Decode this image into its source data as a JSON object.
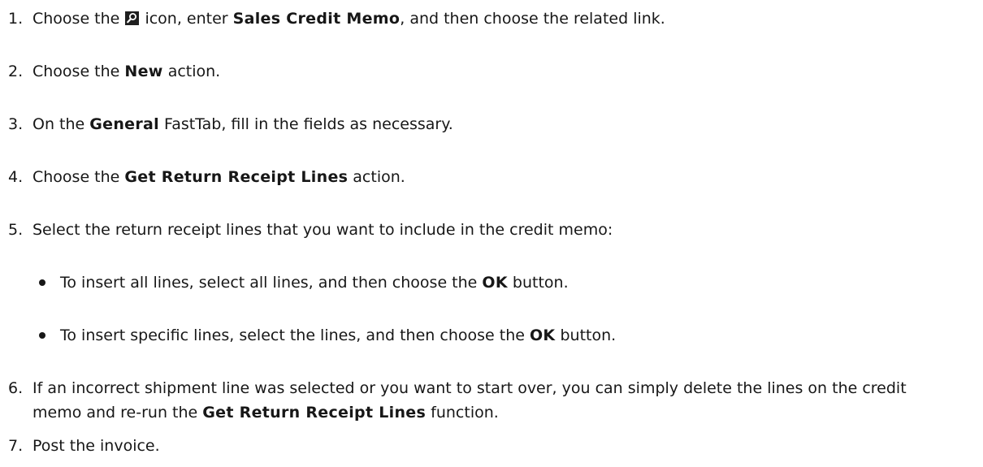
{
  "steps": [
    {
      "number": "1.",
      "parts": [
        {
          "t": "Choose the ",
          "b": false
        },
        {
          "icon": "search-icon"
        },
        {
          "t": " icon, enter ",
          "b": false
        },
        {
          "t": "Sales Credit Memo",
          "b": true
        },
        {
          "t": ", and then choose the related link.",
          "b": false
        }
      ]
    },
    {
      "number": "2.",
      "parts": [
        {
          "t": "Choose the ",
          "b": false
        },
        {
          "t": "New",
          "b": true
        },
        {
          "t": " action.",
          "b": false
        }
      ]
    },
    {
      "number": "3.",
      "parts": [
        {
          "t": "On the ",
          "b": false
        },
        {
          "t": "General",
          "b": true
        },
        {
          "t": " FastTab, fill in the fields as necessary.",
          "b": false
        }
      ]
    },
    {
      "number": "4.",
      "parts": [
        {
          "t": "Choose the ",
          "b": false
        },
        {
          "t": "Get Return Receipt Lines",
          "b": true
        },
        {
          "t": " action.",
          "b": false
        }
      ]
    },
    {
      "number": "5.",
      "parts": [
        {
          "t": "Select the return receipt lines that you want to include in the credit memo:",
          "b": false
        }
      ],
      "bullets": [
        [
          {
            "t": "To insert all lines, select all lines, and then choose the ",
            "b": false
          },
          {
            "t": "OK",
            "b": true
          },
          {
            "t": " button.",
            "b": false
          }
        ],
        [
          {
            "t": "To insert specific lines, select the lines, and then choose the ",
            "b": false
          },
          {
            "t": "OK",
            "b": true
          },
          {
            "t": " button.",
            "b": false
          }
        ]
      ]
    },
    {
      "number": "6.",
      "parts": [
        {
          "t": "If an incorrect shipment line was selected or you want to start over, you can simply delete the lines on the credit memo and re-run the ",
          "b": false
        },
        {
          "t": "Get Return Receipt Lines",
          "b": true
        },
        {
          "t": " function.",
          "b": false
        }
      ]
    },
    {
      "number": "7.",
      "parts": [
        {
          "t": "Post the invoice.",
          "b": false
        }
      ]
    }
  ]
}
